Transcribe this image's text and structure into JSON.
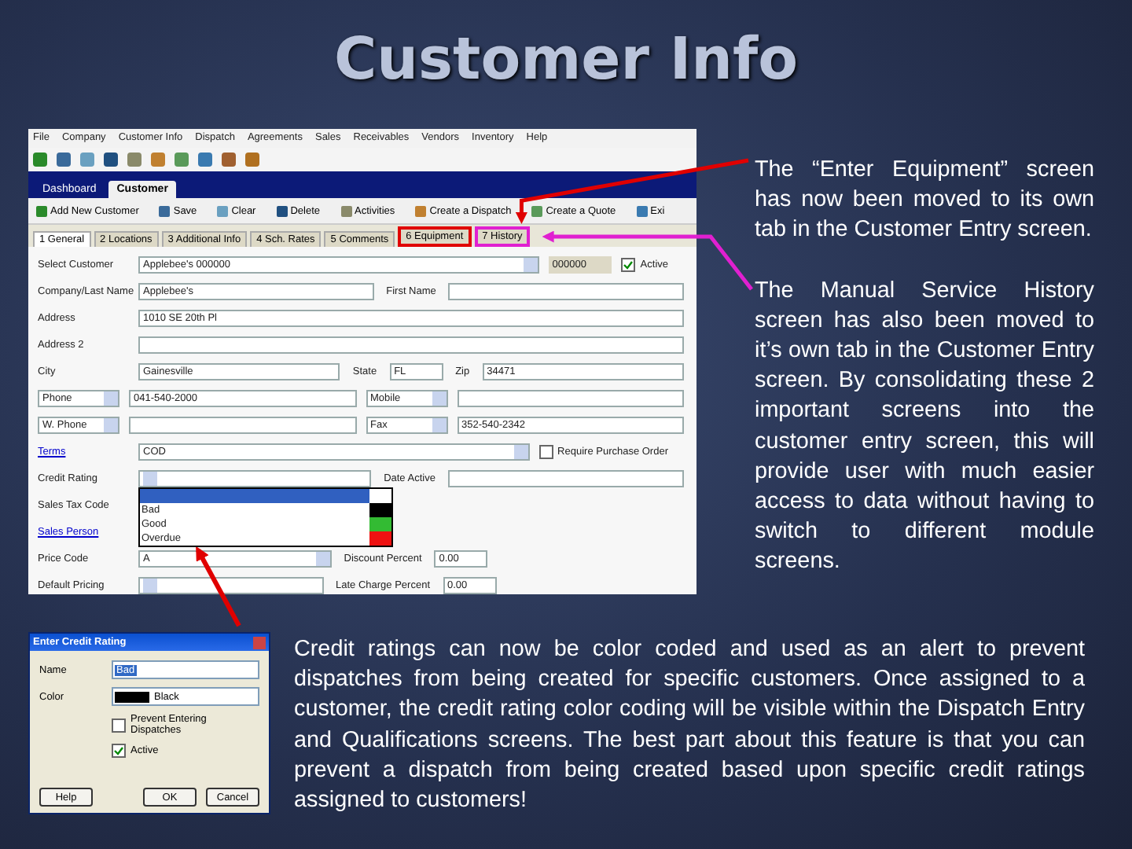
{
  "slide_title": "Customer Info",
  "app": {
    "menu": [
      "File",
      "Company",
      "Customer Info",
      "Dispatch",
      "Agreements",
      "Sales",
      "Receivables",
      "Vendors",
      "Inventory",
      "Help"
    ],
    "tabs": [
      {
        "label": "Dashboard",
        "selected": false
      },
      {
        "label": "Customer",
        "selected": true
      }
    ],
    "actions": [
      "Add New Customer",
      "Save",
      "Clear",
      "Delete",
      "Activities",
      "Create a Dispatch",
      "Create a Quote",
      "Exi"
    ],
    "sub_tabs": [
      {
        "label": "1 General",
        "selected": true
      },
      {
        "label": "2 Locations",
        "selected": false
      },
      {
        "label": "3 Additional Info",
        "selected": false
      },
      {
        "label": "4 Sch. Rates",
        "selected": false
      },
      {
        "label": "5 Comments",
        "selected": false
      },
      {
        "label": "6 Equipment",
        "selected": false,
        "color": "#e00000"
      },
      {
        "label": "7 History",
        "selected": false,
        "color": "#e020d0"
      }
    ],
    "form": [
      {
        "cells": [
          {
            "kind": "label",
            "text": "Select Customer"
          },
          {
            "kind": "select",
            "value": "Applebee's 000000"
          },
          {
            "kind": "code",
            "value": "000000"
          },
          {
            "kind": "check",
            "text": "Active",
            "checked": true
          }
        ]
      },
      {
        "cells": [
          {
            "kind": "label",
            "text": "Company/Last Name"
          },
          {
            "kind": "input",
            "value": "Applebee's"
          },
          {
            "kind": "label",
            "text": "First Name"
          },
          {
            "kind": "input"
          }
        ]
      },
      {
        "cells": [
          {
            "kind": "label",
            "text": "Address"
          },
          {
            "kind": "input",
            "value": "1010 SE 20th Pl"
          }
        ]
      },
      {
        "cells": [
          {
            "kind": "label",
            "text": "Address 2"
          },
          {
            "kind": "input"
          }
        ]
      },
      {
        "cells": [
          {
            "kind": "label",
            "text": "City"
          },
          {
            "kind": "input",
            "value": "Gainesville"
          },
          {
            "kind": "label",
            "text": "State"
          },
          {
            "kind": "short",
            "value": "FL"
          },
          {
            "kind": "label",
            "text": "Zip"
          },
          {
            "kind": "input",
            "value": "34471"
          }
        ]
      },
      {
        "cells": [
          {
            "kind": "pick",
            "value": "Phone"
          },
          {
            "kind": "input",
            "value": "041-540-2000"
          },
          {
            "kind": "pick",
            "value": "Mobile"
          },
          {
            "kind": "input"
          }
        ]
      },
      {
        "cells": [
          {
            "kind": "pick",
            "value": "W. Phone"
          },
          {
            "kind": "input"
          },
          {
            "kind": "pick",
            "value": "Fax"
          },
          {
            "kind": "input",
            "value": "352-540-2342"
          }
        ]
      },
      {
        "cells": [
          {
            "kind": "link",
            "text": "Terms"
          },
          {
            "kind": "select",
            "value": "COD"
          },
          {
            "kind": "check",
            "text": "Require Purchase Order",
            "checked": false
          }
        ]
      },
      {
        "cells": [
          {
            "kind": "label",
            "text": "Credit Rating"
          },
          {
            "kind": "select",
            "open": true,
            "options": [
              {
                "selected": true,
                "color": "#ffffff"
              },
              {
                "text": "Bad",
                "selected": false,
                "color": "#000000"
              },
              {
                "text": "Good",
                "selected": false,
                "color": "#33bb33"
              },
              {
                "text": "Overdue",
                "selected": false,
                "color": "#ee1111"
              }
            ]
          },
          {
            "kind": "label",
            "text": "Date Active"
          },
          {
            "kind": "input"
          }
        ]
      },
      {
        "cells": [
          {
            "kind": "label",
            "text": "Sales Tax Code"
          }
        ]
      },
      {
        "cells": [
          {
            "kind": "link",
            "text": "Sales Person"
          }
        ]
      },
      {
        "cells": [
          {
            "kind": "label",
            "text": "Price Code"
          },
          {
            "kind": "select",
            "value": "A"
          },
          {
            "kind": "label",
            "text": "Discount Percent"
          },
          {
            "kind": "short",
            "value": "0.00"
          },
          {
            "kind": "spacer"
          }
        ]
      },
      {
        "cells": [
          {
            "kind": "label",
            "text": "Default Pricing"
          },
          {
            "kind": "select"
          },
          {
            "kind": "label",
            "text": "Late Charge Percent"
          },
          {
            "kind": "short",
            "value": "0.00"
          },
          {
            "kind": "spacer"
          }
        ]
      }
    ]
  },
  "note_equipment": "The “Enter Equipment” screen has now been moved to its own tab in the Customer Entry screen.",
  "note_history": "The Manual Service History screen has also been moved to it’s own tab in the Customer Entry screen. By consolidating these 2 important screens into the customer entry screen, this will provide user with much easier access to data without having to switch to different module screens.",
  "dialog": {
    "title": "Enter Credit Rating",
    "name_label": "Name",
    "name_value": "Bad",
    "color_label": "Color",
    "color_value": "Black",
    "color": "#000000",
    "checks": [
      {
        "label": "Prevent Entering Dispatches",
        "checked": false
      },
      {
        "label": "Active",
        "checked": true
      }
    ],
    "buttons": [
      "Help",
      "OK",
      "Cancel"
    ]
  },
  "note_credit": "Credit ratings can now be color coded and used as an alert to prevent dispatches from being created for specific customers. Once assigned to a customer, the credit rating color coding will be visible within the Dispatch Entry and Qualifications screens.  The best part about this feature is that you can prevent a dispatch from being created based upon specific credit ratings assigned to customers!"
}
